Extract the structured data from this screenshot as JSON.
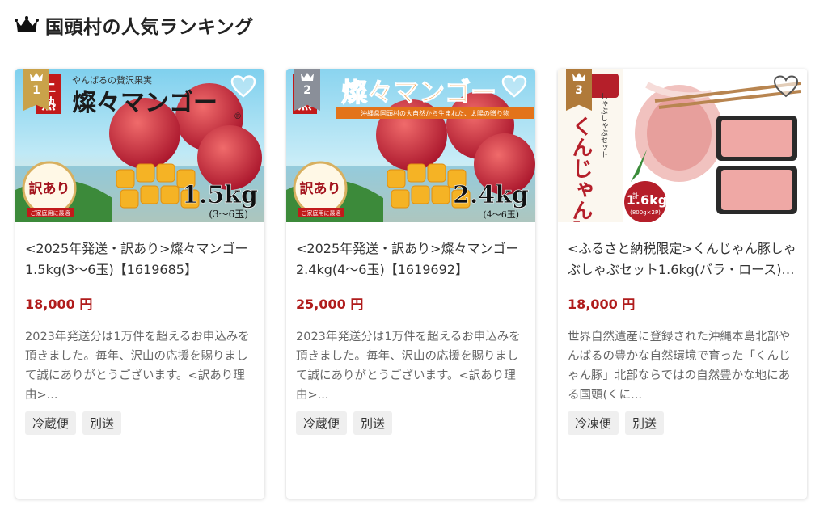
{
  "section": {
    "title": "国頭村の人気ランキング",
    "icon": "crown-icon"
  },
  "cards": [
    {
      "rank": "1",
      "rank_color": "#c9a24a",
      "image_text": {
        "tagline": "やんばるの贅沢果実",
        "badge_top": "上",
        "badge_bottom": "熟",
        "brand": "燦々マンゴー",
        "registered": "®",
        "weight": "1.5kg",
        "count": "(3〜6玉)",
        "wakeari": "訳あり",
        "wakeari_sub": "ご家庭用に最適"
      },
      "name": "<2025年発送・訳あり>燦々マンゴー1.5kg(3〜6玉)【1619685】",
      "price": "18,000 円",
      "description": "2023年発送分は1万件を超えるお申込みを頂きました。毎年、沢山の応援を賜りまして誠にありがとうございます。<訳あり理由>...",
      "tags": [
        "冷蔵便",
        "別送"
      ]
    },
    {
      "rank": "2",
      "rank_color": "#8a8f99",
      "image_text": {
        "tagline": "沖縄県国頭村の大自然から生まれた、太陽の贈り物",
        "badge_top": "上",
        "badge_bottom": "熟",
        "brand": "燦々マンゴー",
        "weight": "2.4kg",
        "count": "(4〜6玉)",
        "wakeari": "訳あり",
        "wakeari_sub": "ご家庭用に最適"
      },
      "name": "<2025年発送・訳あり>燦々マンゴー2.4kg(4〜6玉)【1619692】",
      "price": "25,000 円",
      "description": "2023年発送分は1万件を超えるお申込みを頂きました。毎年、沢山の応援を賜りまして誠にありがとうございます。<訳あり理由>...",
      "tags": [
        "冷蔵便",
        "別送"
      ]
    },
    {
      "rank": "3",
      "rank_color": "#b07a3a",
      "image_text": {
        "label_side": "しゃぶしゃぶセット",
        "brand": "くんじゃん豚",
        "weight": "1.6kg",
        "weight_sub": "(800g×2P)",
        "weight_prefix": "計"
      },
      "name": "<ふるさと納税限定>くんじゃん豚しゃぶしゃぶセット1.6kg(バラ・ロース)…",
      "price": "18,000 円",
      "description": "世界自然遺産に登録された沖縄本島北部やんばるの豊かな自然環境で育った「くんじゃん豚」北部ならではの自然豊かな地にある国頭(くに...",
      "tags": [
        "冷凍便",
        "別送"
      ]
    }
  ]
}
